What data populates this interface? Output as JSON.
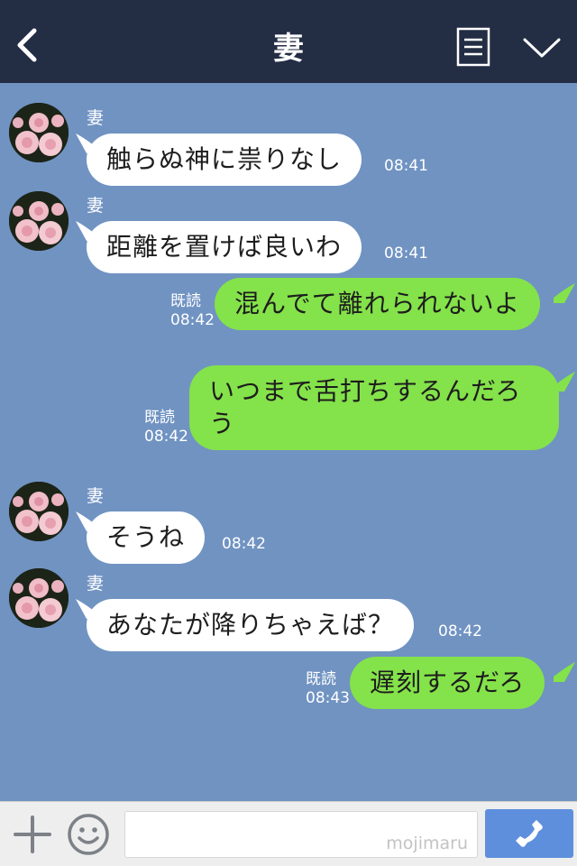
{
  "header": {
    "title": "妻",
    "back_icon": "chevron-left-icon",
    "menu_icon": "list-icon",
    "down_icon": "chevron-down-icon"
  },
  "messages": [
    {
      "side": "in",
      "sender": "妻",
      "text": "触らぬ神に祟りなし",
      "time": "08:41"
    },
    {
      "side": "in",
      "sender": "妻",
      "text": "距離を置けば良いわ",
      "time": "08:41"
    },
    {
      "side": "out",
      "read": "既読",
      "text": "混んでて離れられないよ",
      "time": "08:42"
    },
    {
      "side": "out",
      "read": "既読",
      "text": "いつまで舌打ちするんだろう",
      "time": "08:42"
    },
    {
      "side": "in",
      "sender": "妻",
      "text": "そうね",
      "time": "08:42"
    },
    {
      "side": "in",
      "sender": "妻",
      "text": "あなたが降りちゃえば？",
      "time": "08:42"
    },
    {
      "side": "out",
      "read": "既読",
      "text": "遅刻するだろ",
      "time": "08:43"
    }
  ],
  "input": {
    "placeholder": "",
    "watermark": "mojimaru"
  },
  "colors": {
    "header_bg": "#232d44",
    "chat_bg": "#7093c2",
    "outgoing_bubble": "#84e24a",
    "incoming_bubble": "#ffffff",
    "send_button": "#5e8fdc"
  }
}
